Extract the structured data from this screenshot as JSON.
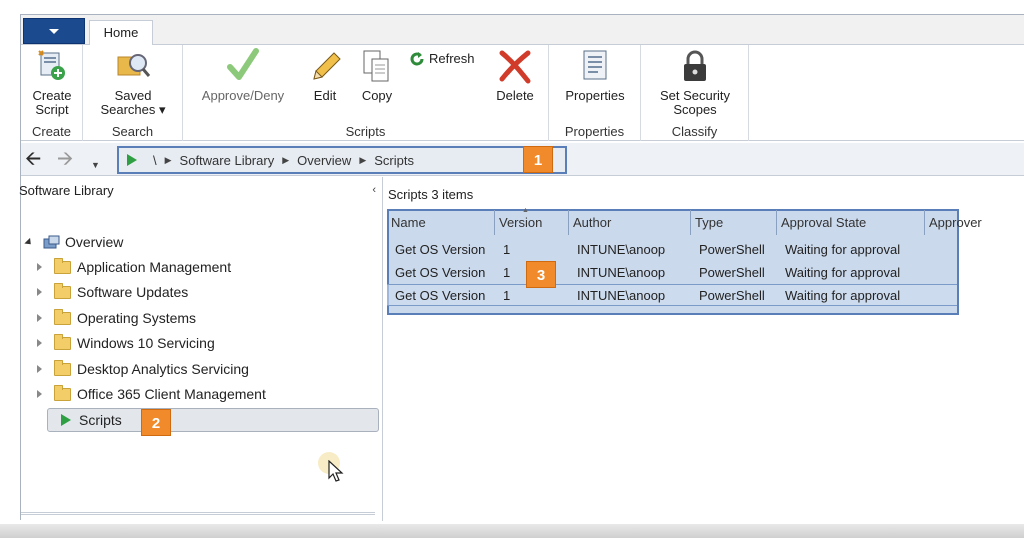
{
  "ribbon": {
    "tabs": [
      {
        "label": "Home",
        "active": true
      }
    ],
    "groups": [
      {
        "label": "Create",
        "buttons": [
          {
            "label": "Create Script",
            "icon": "create-script-icon"
          }
        ]
      },
      {
        "label": "Search",
        "buttons": [
          {
            "label": "Saved Searches",
            "icon": "saved-searches-icon",
            "dropdown": true
          }
        ]
      },
      {
        "label": "Scripts",
        "buttons": [
          {
            "label": "Approve/Deny",
            "icon": "approve-checkmark-icon",
            "enabled": false
          },
          {
            "label": "Edit",
            "icon": "pencil-icon"
          },
          {
            "label": "Copy",
            "icon": "copy-icon"
          },
          {
            "label": "Refresh",
            "icon": "refresh-icon"
          },
          {
            "label": "Delete",
            "icon": "delete-x-icon"
          }
        ]
      },
      {
        "label": "Properties",
        "buttons": [
          {
            "label": "Properties",
            "icon": "properties-icon"
          }
        ]
      },
      {
        "label": "Classify",
        "buttons": [
          {
            "label": "Set Security Scopes",
            "icon": "lock-icon"
          }
        ]
      }
    ],
    "create_script_l1": "Create",
    "create_script_l2": "Script",
    "saved_searches_l1": "Saved",
    "saved_searches_l2": "Searches ▾",
    "set_scopes_l1": "Set Security",
    "set_scopes_l2": "Scopes"
  },
  "navigation": {
    "back_icon": "back-arrow-icon",
    "forward_icon": "forward-arrow-icon",
    "dropdown_icon": "chevron-down-icon",
    "breadcrumb": [
      "\\",
      "Software Library",
      "Overview",
      "Scripts"
    ],
    "callout_label": "1"
  },
  "left_pane": {
    "title": "Software Library",
    "collapse_glyph": "‹",
    "root": "Overview",
    "items": [
      {
        "label": "Application Management"
      },
      {
        "label": "Software Updates"
      },
      {
        "label": "Operating Systems"
      },
      {
        "label": "Windows 10 Servicing"
      },
      {
        "label": "Desktop Analytics Servicing"
      },
      {
        "label": "Office 365 Client Management"
      }
    ],
    "selected_item": "Scripts",
    "callout_label": "2"
  },
  "right_pane": {
    "title": "Scripts 3 items",
    "columns": [
      "Name",
      "Version",
      "Author",
      "Type",
      "Approval State",
      "Approver"
    ],
    "rows": [
      {
        "name": "Get OS Version",
        "version": "1",
        "author": "INTUNE\\anoop",
        "type": "PowerShell",
        "approval_state": "Waiting for approval",
        "approver": ""
      },
      {
        "name": "Get OS Version",
        "version": "1",
        "author": "INTUNE\\anoop",
        "type": "PowerShell",
        "approval_state": "Waiting for approval",
        "approver": ""
      },
      {
        "name": "Get OS Version",
        "version": "1",
        "author": "INTUNE\\anoop",
        "type": "PowerShell",
        "approval_state": "Waiting for approval",
        "approver": ""
      }
    ],
    "callout_label": "3"
  },
  "colors": {
    "accent_blue": "#1b4b8e",
    "callout_orange": "#f08a2a",
    "highlight_border": "#5a7fb8",
    "play_green": "#2ea043"
  }
}
